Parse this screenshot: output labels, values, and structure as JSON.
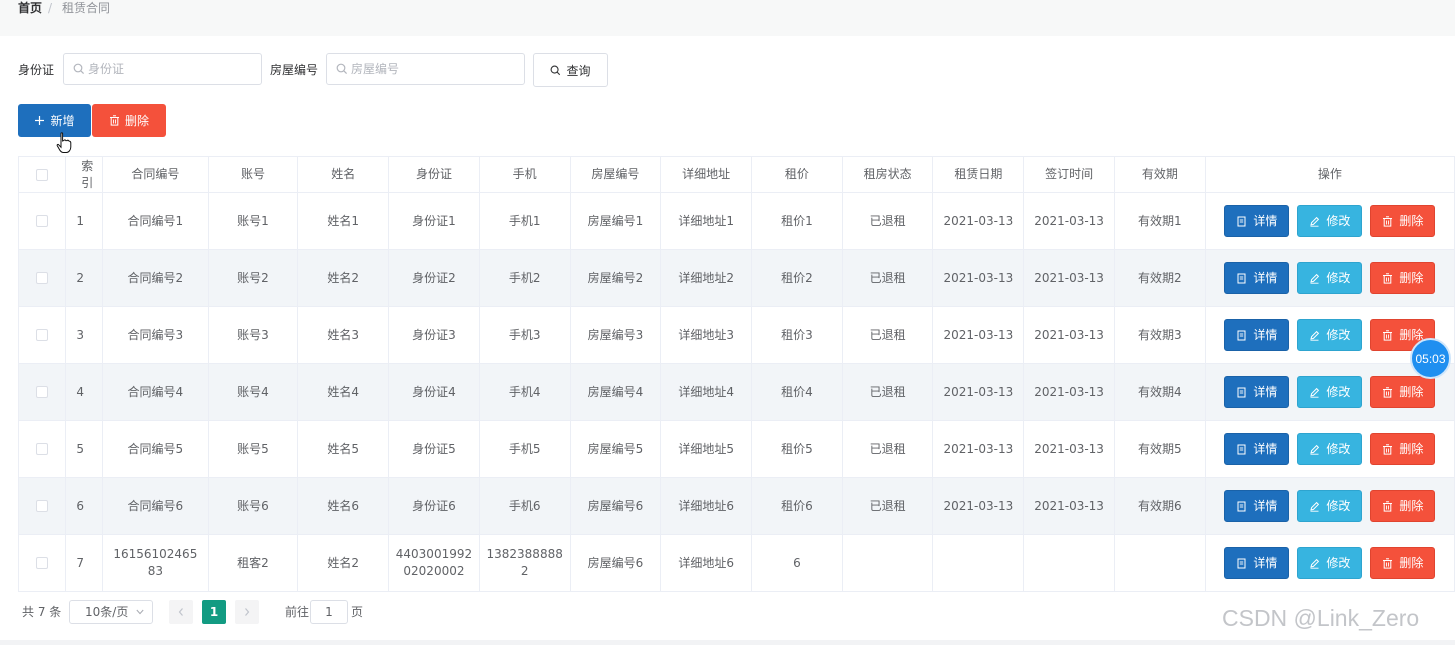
{
  "breadcrumb": {
    "home": "首页",
    "sep": "/",
    "current": "租赁合同"
  },
  "search": {
    "id_label": "身份证",
    "id_placeholder": "身份证",
    "house_label": "房屋编号",
    "house_placeholder": "房屋编号",
    "query_button": "查询"
  },
  "toolbar": {
    "add_label": "新增",
    "delete_label": "删除"
  },
  "table": {
    "headers": [
      "索引",
      "合同编号",
      "账号",
      "姓名",
      "身份证",
      "手机",
      "房屋编号",
      "详细地址",
      "租价",
      "租房状态",
      "租赁日期",
      "签订时间",
      "有效期",
      "操作"
    ],
    "rows": [
      [
        "1",
        "合同编号1",
        "账号1",
        "姓名1",
        "身份证1",
        "手机1",
        "房屋编号1",
        "详细地址1",
        "租价1",
        "已退租",
        "2021-03-13",
        "2021-03-13",
        "有效期1"
      ],
      [
        "2",
        "合同编号2",
        "账号2",
        "姓名2",
        "身份证2",
        "手机2",
        "房屋编号2",
        "详细地址2",
        "租价2",
        "已退租",
        "2021-03-13",
        "2021-03-13",
        "有效期2"
      ],
      [
        "3",
        "合同编号3",
        "账号3",
        "姓名3",
        "身份证3",
        "手机3",
        "房屋编号3",
        "详细地址3",
        "租价3",
        "已退租",
        "2021-03-13",
        "2021-03-13",
        "有效期3"
      ],
      [
        "4",
        "合同编号4",
        "账号4",
        "姓名4",
        "身份证4",
        "手机4",
        "房屋编号4",
        "详细地址4",
        "租价4",
        "已退租",
        "2021-03-13",
        "2021-03-13",
        "有效期4"
      ],
      [
        "5",
        "合同编号5",
        "账号5",
        "姓名5",
        "身份证5",
        "手机5",
        "房屋编号5",
        "详细地址5",
        "租价5",
        "已退租",
        "2021-03-13",
        "2021-03-13",
        "有效期5"
      ],
      [
        "6",
        "合同编号6",
        "账号6",
        "姓名6",
        "身份证6",
        "手机6",
        "房屋编号6",
        "详细地址6",
        "租价6",
        "已退租",
        "2021-03-13",
        "2021-03-13",
        "有效期6"
      ],
      [
        "7",
        "16156102465 83",
        "租客2",
        "姓名2",
        "4403001992 02020002",
        "1382388888 2",
        "房屋编号6",
        "详细地址6",
        "6",
        "",
        "",
        "",
        ""
      ]
    ],
    "actions": {
      "detail": "详情",
      "edit": "修改",
      "delete": "删除"
    }
  },
  "pagination": {
    "total": "共 7 条",
    "page_size": "10条/页",
    "current": "1",
    "goto_label": "前往",
    "goto_value": "1",
    "page_suffix": "页"
  },
  "overlay": {
    "timer": "05:03",
    "watermark": "CSDN @Link_Zero"
  },
  "colors": {
    "primary": "#1e6fbd",
    "danger": "#f4513b",
    "info": "#37b4e0",
    "pager_active": "#129b82"
  }
}
